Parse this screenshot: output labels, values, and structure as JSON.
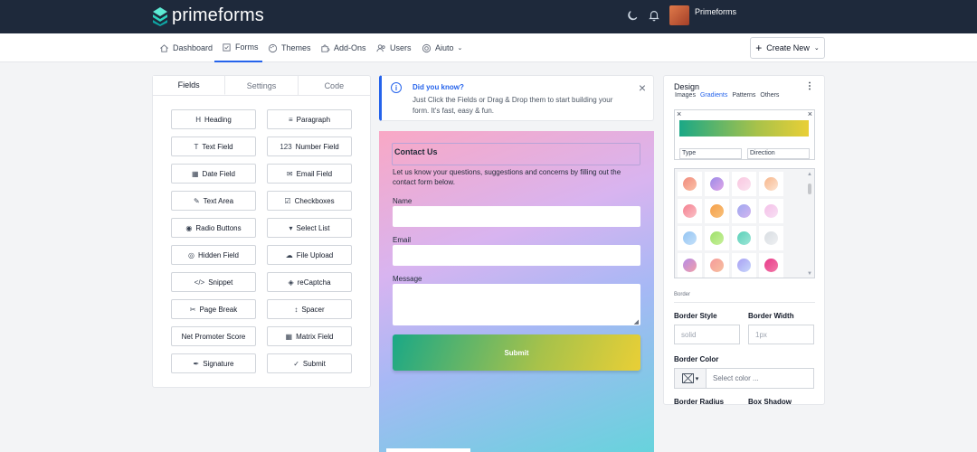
{
  "app": {
    "name": "primeforms",
    "user": "Primeforms"
  },
  "nav": {
    "items": [
      {
        "label": "Dashboard",
        "icon": "home-icon"
      },
      {
        "label": "Forms",
        "icon": "form-icon",
        "active": true
      },
      {
        "label": "Themes",
        "icon": "palette-icon"
      },
      {
        "label": "Add-Ons",
        "icon": "puzzle-icon"
      },
      {
        "label": "Users",
        "icon": "users-icon"
      },
      {
        "label": "Aiuto",
        "icon": "help-icon"
      }
    ],
    "create_label": "Create New"
  },
  "fields_panel": {
    "tabs": [
      "Fields",
      "Settings",
      "Code"
    ],
    "buttons": [
      {
        "label": "Heading",
        "glyph": "H"
      },
      {
        "label": "Paragraph",
        "glyph": "≡"
      },
      {
        "label": "Text Field",
        "glyph": "T"
      },
      {
        "label": "Number Field",
        "glyph": "123"
      },
      {
        "label": "Date Field",
        "glyph": "▦"
      },
      {
        "label": "Email Field",
        "glyph": "✉"
      },
      {
        "label": "Text Area",
        "glyph": "✎"
      },
      {
        "label": "Checkboxes",
        "glyph": "☑"
      },
      {
        "label": "Radio Buttons",
        "glyph": "◉"
      },
      {
        "label": "Select List",
        "glyph": "▾"
      },
      {
        "label": "Hidden Field",
        "glyph": "◎"
      },
      {
        "label": "File Upload",
        "glyph": "☁"
      },
      {
        "label": "Snippet",
        "glyph": "</>"
      },
      {
        "label": "reCaptcha",
        "glyph": "◈"
      },
      {
        "label": "Page Break",
        "glyph": "✂"
      },
      {
        "label": "Spacer",
        "glyph": "↕"
      },
      {
        "label": "Net Promoter Score",
        "glyph": ""
      },
      {
        "label": "Matrix Field",
        "glyph": "▦"
      },
      {
        "label": "Signature",
        "glyph": "✒"
      },
      {
        "label": "Submit",
        "glyph": "✓"
      }
    ]
  },
  "info": {
    "title": "Did you know?",
    "text": "Just Click the Fields or Drag & Drop them to start building your form. It's fast, easy & fun."
  },
  "form": {
    "title": "Contact Us",
    "description": "Let us know your questions, suggestions and concerns by filling out the contact form below.",
    "labels": {
      "name": "Name",
      "email": "Email",
      "message": "Message"
    },
    "submit": "Submit"
  },
  "design": {
    "title": "Design",
    "sub_tabs": [
      "Images",
      "Gradients",
      "Patterns",
      "Others"
    ],
    "gradient": {
      "type_placeholder": "Type",
      "direction_placeholder": "Direction"
    },
    "swatches": [
      [
        "#f08a7c",
        "#fbc2a8"
      ],
      [
        "#9b8ae8",
        "#e0a7e8"
      ],
      [
        "#f9c7e0",
        "#fbe3f0"
      ],
      [
        "#f7b58a",
        "#fde6d4"
      ],
      [
        "#f47f8f",
        "#fbc2c8"
      ],
      [
        "#f5a04a",
        "#f8c07a"
      ],
      [
        "#9fa8f0",
        "#d4b5f0"
      ],
      [
        "#f4c0e8",
        "#f8e0f4"
      ],
      [
        "#93c4f2",
        "#c4e0fa"
      ],
      [
        "#9ee06a",
        "#c8f09c"
      ],
      [
        "#5ad0b8",
        "#9ee6d8"
      ],
      [
        "#d8dde2",
        "#eef0f2"
      ],
      [
        "#b58ae8",
        "#f2a0a8"
      ],
      [
        "#f59a9a",
        "#f7c0a0"
      ],
      [
        "#a8a0f4",
        "#c8d8fb"
      ],
      [
        "#e83a8a",
        "#f27aa8"
      ]
    ],
    "border_section": "Border",
    "border_style_label": "Border Style",
    "border_style_value": "solid",
    "border_width_label": "Border Width",
    "border_width_value": "1px",
    "border_color_label": "Border Color",
    "color_placeholder": "Select color ...",
    "border_radius_label": "Border Radius",
    "box_shadow_label": "Box Shadow"
  }
}
